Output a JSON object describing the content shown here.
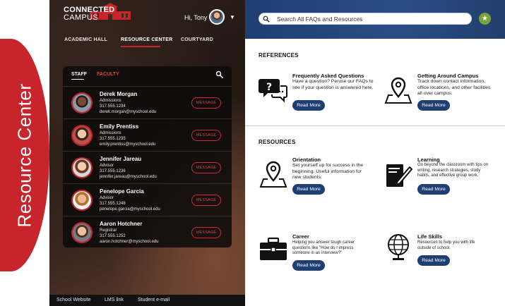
{
  "side_tab": {
    "label": "Resource Center",
    "color": "#c8242b"
  },
  "app": {
    "logo_line1": "CONNECTED",
    "logo_line2": "CAMPUS",
    "greeting": "Hi, Tony",
    "caret": "▼"
  },
  "main_nav": [
    {
      "label": "ACADEMIC HALL",
      "active": false
    },
    {
      "label": "RESOURCE CENTER",
      "active": true
    },
    {
      "label": "COURTYARD",
      "active": false
    }
  ],
  "directory": {
    "tabs": [
      {
        "label": "STAFF",
        "active": true
      },
      {
        "label": "FACULTY",
        "active": false
      }
    ],
    "search_icon": "search-icon",
    "contacts": [
      {
        "name": "Derek Morgan",
        "dept": "Admissions",
        "phone": "317.555.1234",
        "email": "derek.morgan@myschool.edu",
        "button": "MESSAGE"
      },
      {
        "name": "Emily Prentiss",
        "dept": "Admissions",
        "phone": "317.555.1235",
        "email": "emily.prentiss@myschool.edu",
        "button": "MESSAGE"
      },
      {
        "name": "Jennifer Jareau",
        "dept": "Advisor",
        "phone": "317.555.1236",
        "email": "jennifer.jareau@myschool.edu",
        "button": "MESSAGE"
      },
      {
        "name": "Penelope Garcia",
        "dept": "Advisor",
        "phone": "317.555.1248",
        "email": "penelope.garcia@myschool.edu",
        "button": "MESSAGE"
      },
      {
        "name": "Aaron Hotchner",
        "dept": "Registrar",
        "phone": "317.555.1252",
        "email": "aaron.hotchner@myschool.edu",
        "button": "MESSAGE"
      }
    ]
  },
  "footer": [
    "School Website",
    "LMS link",
    "Student e-mail"
  ],
  "search": {
    "placeholder": "Search All FAQs and Resources"
  },
  "favorite_icon": "star-icon",
  "references": {
    "title": "REFERENCES",
    "items": [
      {
        "title": "Frequently Asked Questions",
        "desc": "Have a question? Peruse our FAQs to see if your question is answered here.",
        "icon": "chat-question-icon",
        "button": "Read More"
      },
      {
        "title": "Getting Around Campus",
        "desc": "Track down contact information, office locations, and other facilities all over campus.",
        "icon": "map-pin-icon",
        "button": "Read More"
      }
    ]
  },
  "resources": {
    "title": "RESOURCES",
    "items": [
      {
        "title": "Orientation",
        "desc": "Set yourself up for success in the beginning. Useful information for new students.",
        "icon": "map-pin-icon",
        "button": "Read More"
      },
      {
        "title": "Learning",
        "desc": "Go beyond the classroom with tips on writing, research strategies, study habits, and effective group work.",
        "icon": "notebook-pen-icon",
        "button": "Read More"
      },
      {
        "title": "Career",
        "desc": "Helping you answer tough career questions like \"How do I impress someone in an interview?\"",
        "icon": "briefcase-icon",
        "button": "Read More"
      },
      {
        "title": "Life Skills",
        "desc": "Resources to help you with life outside of school.",
        "icon": "globe-icon",
        "button": "Read More"
      }
    ]
  }
}
